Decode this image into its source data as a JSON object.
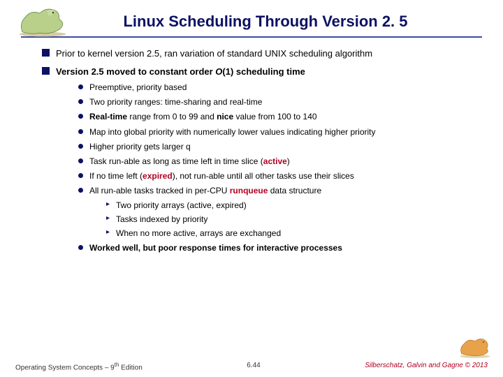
{
  "title": "Linux Scheduling Through Version 2. 5",
  "bullets": {
    "b1": "Prior to kernel version 2.5, ran variation of standard UNIX scheduling algorithm",
    "b2_pre": "Version 2.5 moved to constant order ",
    "b2_o": "O",
    "b2_post": "(1) scheduling time",
    "s1": "Preemptive, priority based",
    "s2": "Two priority ranges: time-sharing and real-time",
    "s3_a": "Real-time",
    "s3_b": " range from 0 to 99 and ",
    "s3_c": "nice",
    "s3_d": " value from 100 to 140",
    "s4": "Map into  global priority with numerically lower values indicating higher priority",
    "s5": "Higher priority gets larger q",
    "s6_a": "Task run-able as long as time left in time slice (",
    "s6_b": "active",
    "s6_c": ")",
    "s7_a": "If no time left (",
    "s7_b": "expired",
    "s7_c": "), not run-able until all other tasks use their slices",
    "s8_a": "All run-able tasks tracked in per-CPU ",
    "s8_b": "runqueue",
    "s8_c": " data structure",
    "ss1": "Two priority arrays (active, expired)",
    "ss2": "Tasks indexed by priority",
    "ss3": "When no more active, arrays are exchanged",
    "s9": "Worked well, but poor response times for interactive processes"
  },
  "footer": {
    "left_a": "Operating System Concepts – 9",
    "left_b": "th",
    "left_c": " Edition",
    "center": "6.44",
    "right": "Silberschatz, Galvin and Gagne © 2013"
  }
}
